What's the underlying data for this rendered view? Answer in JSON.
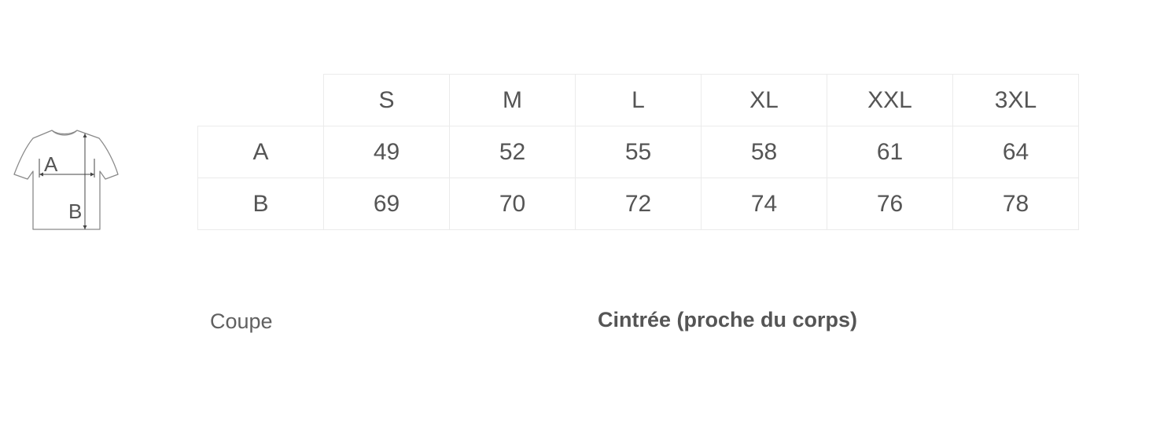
{
  "diagram": {
    "label_a": "A",
    "label_b": "B"
  },
  "size_table": {
    "sizes": [
      "S",
      "M",
      "L",
      "XL",
      "XXL",
      "3XL"
    ],
    "rows": [
      {
        "label": "A",
        "values": [
          "49",
          "52",
          "55",
          "58",
          "61",
          "64"
        ]
      },
      {
        "label": "B",
        "values": [
          "69",
          "70",
          "72",
          "74",
          "76",
          "78"
        ]
      }
    ]
  },
  "fit": {
    "label": "Coupe",
    "value": "Cintrée (proche du corps)"
  }
}
